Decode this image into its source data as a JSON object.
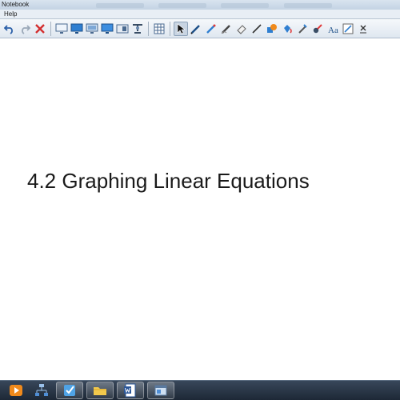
{
  "window": {
    "title": "Notebook"
  },
  "menu": {
    "items": [
      "Help"
    ]
  },
  "toolbar": {
    "icons": [
      "undo-icon",
      "redo-icon",
      "delete-icon",
      "screen-shade-icon",
      "display-icon",
      "monitor-icon",
      "screen-icon",
      "capture-icon",
      "document-camera-icon",
      "table-icon",
      "select-pointer-icon",
      "pen-icon",
      "creative-pen-icon",
      "magic-pen-icon",
      "eraser-icon",
      "line-icon",
      "shape-icon",
      "fill-icon",
      "text-pen-icon",
      "recognize-icon",
      "text-icon",
      "properties-icon",
      "more-tools-icon"
    ]
  },
  "page": {
    "title": "4.2 Graphing Linear Equations"
  },
  "taskbar": {
    "items": [
      "media-player-icon",
      "network-icon",
      "notebook-icon",
      "file-manager-icon",
      "word-icon",
      "window-icon"
    ]
  },
  "colors": {
    "toolbar_bg": "#e6edf5",
    "taskbar_bg": "#26323f",
    "text": "#1a1a1a"
  }
}
